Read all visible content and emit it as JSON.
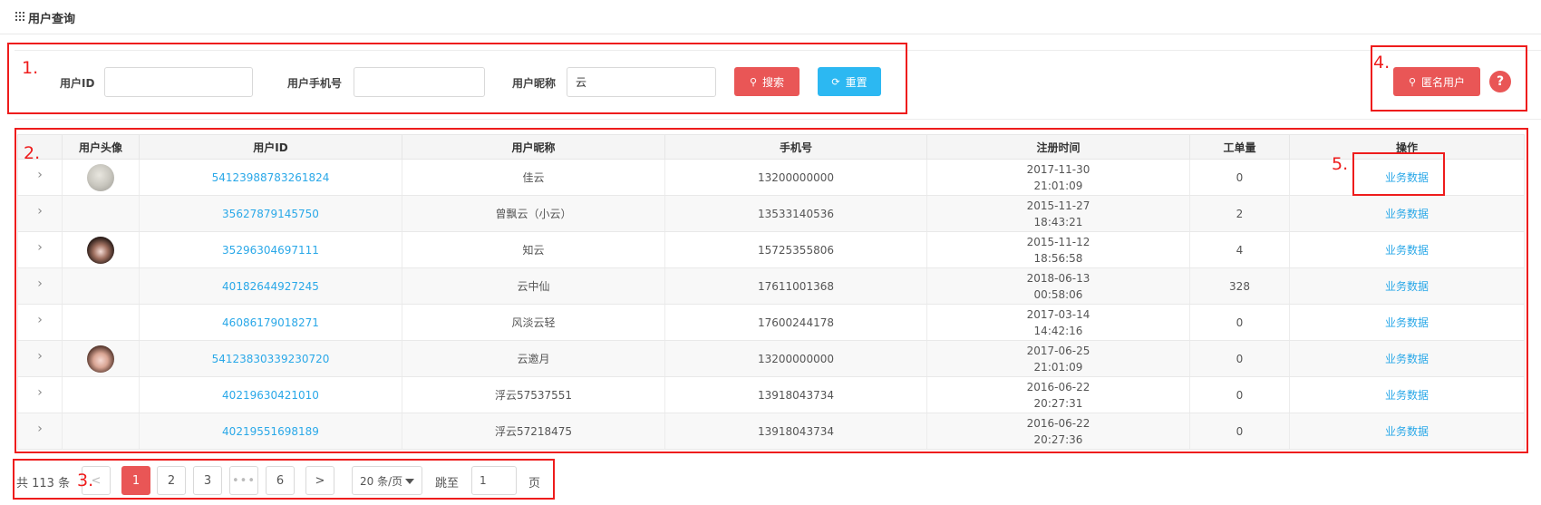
{
  "header": {
    "title": "用户查询"
  },
  "filters": {
    "user_id_label": "用户ID",
    "user_id_value": "",
    "phone_label": "用户手机号",
    "phone_value": "",
    "nickname_label": "用户昵称",
    "nickname_value": "云",
    "search_label": "搜索",
    "reset_label": "重置",
    "anonymous_label": "匿名用户",
    "help_label": "?"
  },
  "colors": {
    "accent_red": "#e95656",
    "accent_blue": "#2cb8f2",
    "link_blue": "#2aa8e8",
    "annotation_red": "#ee1c1c"
  },
  "table": {
    "columns": [
      "",
      "用户头像",
      "用户ID",
      "用户昵称",
      "手机号",
      "注册时间",
      "工单量",
      "操作"
    ],
    "rows": [
      {
        "has_avatar": true,
        "user_id": "54123988783261824",
        "nickname": "佳云",
        "phone": "13200000000",
        "reg_date": "2017-11-30",
        "reg_time": "21:01:09",
        "orders": "0",
        "action": "业务数据"
      },
      {
        "has_avatar": false,
        "user_id": "35627879145750",
        "nickname": "曾飘云（小云）",
        "phone": "13533140536",
        "reg_date": "2015-11-27",
        "reg_time": "18:43:21",
        "orders": "2",
        "action": "业务数据"
      },
      {
        "has_avatar": true,
        "user_id": "35296304697111",
        "nickname": "知云",
        "phone": "15725355806",
        "reg_date": "2015-11-12",
        "reg_time": "18:56:58",
        "orders": "4",
        "action": "业务数据"
      },
      {
        "has_avatar": false,
        "user_id": "40182644927245",
        "nickname": "云中仙",
        "phone": "17611001368",
        "reg_date": "2018-06-13",
        "reg_time": "00:58:06",
        "orders": "328",
        "action": "业务数据"
      },
      {
        "has_avatar": false,
        "user_id": "46086179018271",
        "nickname": "风淡云轻",
        "phone": "17600244178",
        "reg_date": "2017-03-14",
        "reg_time": "14:42:16",
        "orders": "0",
        "action": "业务数据"
      },
      {
        "has_avatar": true,
        "user_id": "54123830339230720",
        "nickname": "云邀月",
        "phone": "13200000000",
        "reg_date": "2017-06-25",
        "reg_time": "21:01:09",
        "orders": "0",
        "action": "业务数据"
      },
      {
        "has_avatar": false,
        "user_id": "40219630421010",
        "nickname": "浮云57537551",
        "phone": "13918043734",
        "reg_date": "2016-06-22",
        "reg_time": "20:27:31",
        "orders": "0",
        "action": "业务数据"
      },
      {
        "has_avatar": false,
        "user_id": "40219551698189",
        "nickname": "浮云57218475",
        "phone": "13918043734",
        "reg_date": "2016-06-22",
        "reg_time": "20:27:36",
        "orders": "0",
        "action": "业务数据"
      }
    ]
  },
  "pagination": {
    "total_text": "共 113 条",
    "prev": "<",
    "pages": [
      "1",
      "2",
      "3",
      "•••",
      "6"
    ],
    "current": "1",
    "next": ">",
    "page_size": "20 条/页",
    "jump_label": "跳至",
    "jump_value": "1",
    "page_suffix": "页"
  },
  "annotations": [
    "1.",
    "2.",
    "3.",
    "4.",
    "5."
  ]
}
